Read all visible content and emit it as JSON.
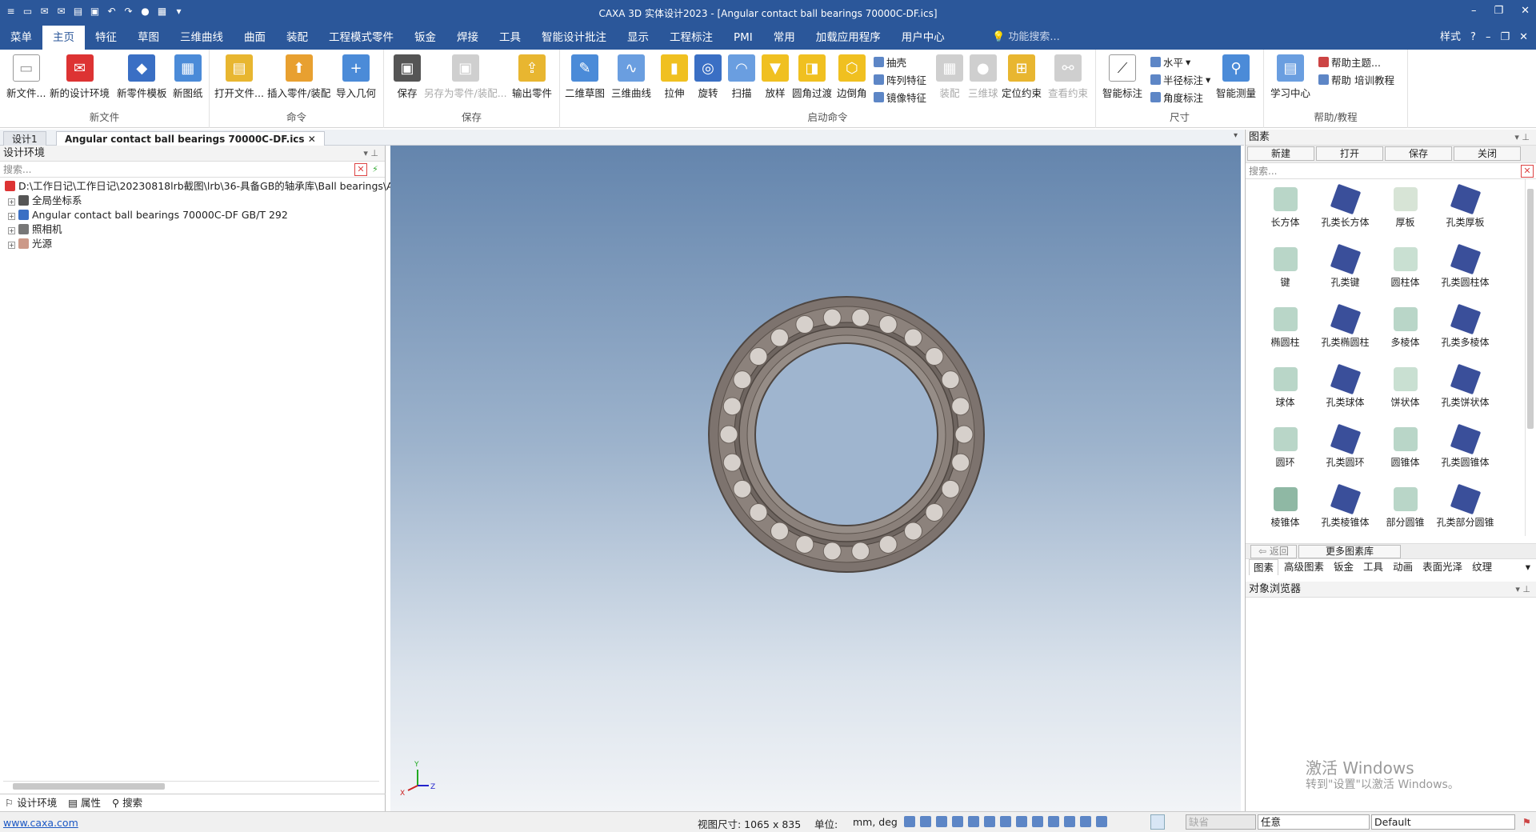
{
  "titlebar": {
    "title": "CAXA 3D 实体设计2023 - [Angular contact ball bearings 70000C-DF.ics]"
  },
  "menu": {
    "tabs": [
      "菜单",
      "主页",
      "特征",
      "草图",
      "三维曲线",
      "曲面",
      "装配",
      "工程模式零件",
      "钣金",
      "焊接",
      "工具",
      "智能设计批注",
      "显示",
      "工程标注",
      "PMI",
      "常用",
      "加载应用程序",
      "用户中心"
    ],
    "active": 1,
    "search_placeholder": "功能搜索...",
    "style_label": "样式"
  },
  "ribbon": {
    "new_file": {
      "label": "新文件",
      "buttons": [
        "新文件...",
        "新的设计环境",
        "新零件模板",
        "新图纸"
      ]
    },
    "command": {
      "label": "命令",
      "buttons": [
        "打开文件...",
        "插入零件/装配",
        "导入几何"
      ]
    },
    "save": {
      "label": "保存",
      "buttons": [
        "保存",
        "另存为零件/装配...",
        "输出零件"
      ]
    },
    "start": {
      "label": "启动命令",
      "buttons": [
        "二维草图",
        "三维曲线",
        "拉伸",
        "旋转",
        "扫描",
        "放样",
        "圆角过渡",
        "边倒角"
      ],
      "small": [
        "抽壳",
        "阵列特征",
        "镜像特征"
      ],
      "buttons2": [
        "装配",
        "三维球",
        "定位约束",
        "查看约束"
      ]
    },
    "dim": {
      "label": "尺寸",
      "buttons": [
        "智能标注"
      ],
      "small": [
        "水平",
        "半径标注",
        "角度标注"
      ],
      "buttons2": [
        "智能测量"
      ]
    },
    "help": {
      "label": "帮助/教程",
      "buttons": [
        "学习中心"
      ],
      "small": [
        "帮助主题...",
        "帮助 培训教程"
      ]
    }
  },
  "doctabs": [
    "设计1",
    "Angular contact ball bearings 70000C-DF.ics"
  ],
  "left": {
    "header": "设计环境",
    "search": "搜索...",
    "tree": [
      "D:\\工作日记\\工作日记\\20230818lrb截图\\lrb\\36-具备GB的轴承库\\Ball bearings\\An",
      "全局坐标系",
      "Angular contact ball bearings 70000C-DF GB/T 292",
      "照相机",
      "光源"
    ],
    "bottom_tabs": [
      "设计环境",
      "属性",
      "搜索"
    ]
  },
  "right": {
    "header": "图素",
    "toolbar": [
      "新建",
      "打开",
      "保存",
      "关闭"
    ],
    "search": "搜索...",
    "items": [
      "长方体",
      "孔类长方体",
      "厚板",
      "孔类厚板",
      "键",
      "孔类键",
      "圆柱体",
      "孔类圆柱体",
      "椭圆柱",
      "孔类椭圆柱",
      "多棱体",
      "孔类多棱体",
      "球体",
      "孔类球体",
      "饼状体",
      "孔类饼状体",
      "圆环",
      "孔类圆环",
      "圆锥体",
      "孔类圆锥体",
      "棱锥体",
      "孔类棱锥体",
      "部分圆锥",
      "孔类部分圆锥"
    ],
    "back": "返回",
    "more": "更多图素库",
    "tabs": [
      "图素",
      "高级图素",
      "钣金",
      "工具",
      "动画",
      "表面光泽",
      "纹理"
    ],
    "object_browser": "对象浏览器"
  },
  "axes": {
    "y": "Y",
    "x": "X",
    "z": "Z"
  },
  "status": {
    "link": "www.caxa.com",
    "viewsize_label": "视图尺寸: 1065 x  835",
    "unit_label": "单位:",
    "unit_value": "mm, deg",
    "combo1": "缺省",
    "combo2": "任意",
    "combo3": "Default"
  },
  "watermark": {
    "line1": "激活 Windows",
    "line2": "转到\"设置\"以激活 Windows。"
  },
  "colors": {
    "accent": "#2b579a"
  }
}
